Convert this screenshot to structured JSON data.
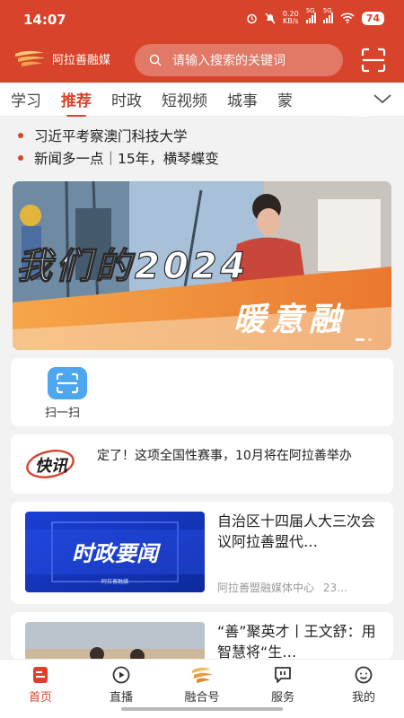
{
  "status_bar": {
    "time": "14:07",
    "net_speed_value": "0.20",
    "net_speed_unit": "KB/s",
    "sim1": "5G",
    "sim2": "5G",
    "battery": "74"
  },
  "header": {
    "app_name": "阿拉善融媒",
    "search_placeholder": "请输入搜索的关键词"
  },
  "tabs": [
    {
      "label": "学习",
      "active": false
    },
    {
      "label": "推荐",
      "active": true
    },
    {
      "label": "时政",
      "active": false
    },
    {
      "label": "短视频",
      "active": false
    },
    {
      "label": "城事",
      "active": false
    },
    {
      "label": "蒙",
      "active": false
    }
  ],
  "headlines": [
    "习近平考察澳门科技大学",
    "新闻多一点｜15年，横琴蝶变"
  ],
  "banner": {
    "title": "我们的2024",
    "subtitle": "暖意融"
  },
  "quick_actions": [
    {
      "label": "扫一扫",
      "icon": "scan-icon"
    }
  ],
  "flash": {
    "badge": "快讯",
    "text": "定了！这项全国性赛事，10月将在阿拉善举办"
  },
  "articles": [
    {
      "thumb_text": "时政要闻",
      "thumb_sub": "阿拉善融媒",
      "title": "自治区十四届人大三次会议阿拉善盟代…",
      "source": "阿拉善盟融媒体中心",
      "time": "23…"
    },
    {
      "thumb_text": "",
      "thumb_sub": "",
      "title": "“善”聚英才丨王文舒：用智慧将“生…",
      "source": "",
      "time": ""
    }
  ],
  "bottom_nav": [
    {
      "label": "首页",
      "icon": "home-icon",
      "active": true
    },
    {
      "label": "直播",
      "icon": "live-icon",
      "active": false
    },
    {
      "label": "融合号",
      "icon": "ronghe-logo-icon",
      "active": false
    },
    {
      "label": "服务",
      "icon": "service-icon",
      "active": false
    },
    {
      "label": "我的",
      "icon": "profile-icon",
      "active": false
    }
  ],
  "colors": {
    "brand_red": "#d7442b",
    "scan_blue": "#4da6f0"
  }
}
